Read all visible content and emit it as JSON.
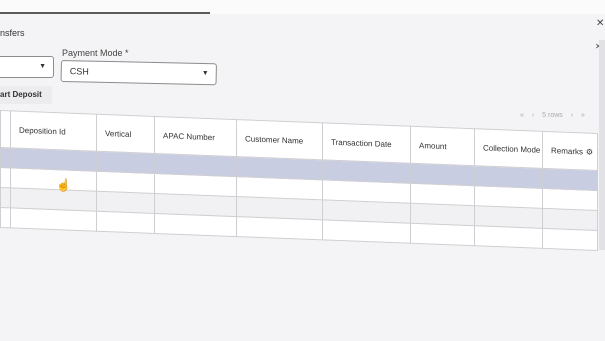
{
  "tab": {
    "label": "nsfers"
  },
  "payment_mode": {
    "label": "Payment Mode *",
    "value": "CSH"
  },
  "first_select": {
    "value": ""
  },
  "deposit_button": {
    "label": "art Deposit"
  },
  "pager": {
    "info": "5 rows"
  },
  "table": {
    "columns": [
      "Deposition Id",
      "Vertical",
      "APAC Number",
      "Customer Name",
      "Transaction Date",
      "Amount",
      "Collection Mode",
      "Remarks"
    ],
    "rows": [
      {
        "cells": [
          "",
          "",
          "",
          "",
          "",
          "",
          "",
          ""
        ]
      },
      {
        "cells": [
          "",
          "",
          "",
          "",
          "",
          "",
          "",
          ""
        ]
      },
      {
        "cells": [
          "",
          "",
          "",
          "",
          "",
          "",
          "",
          ""
        ]
      },
      {
        "cells": [
          "",
          "",
          "",
          "",
          "",
          "",
          "",
          ""
        ]
      }
    ],
    "selected_row": 0
  },
  "colors": {
    "selected_row": "#c9cde2",
    "border": "#cfcfd3",
    "stripe": "#f1f1f3"
  },
  "icons": [
    "close-icon",
    "caret-down-icon",
    "gear-icon",
    "hand-cursor-icon",
    "pager-arrow-icon"
  ]
}
